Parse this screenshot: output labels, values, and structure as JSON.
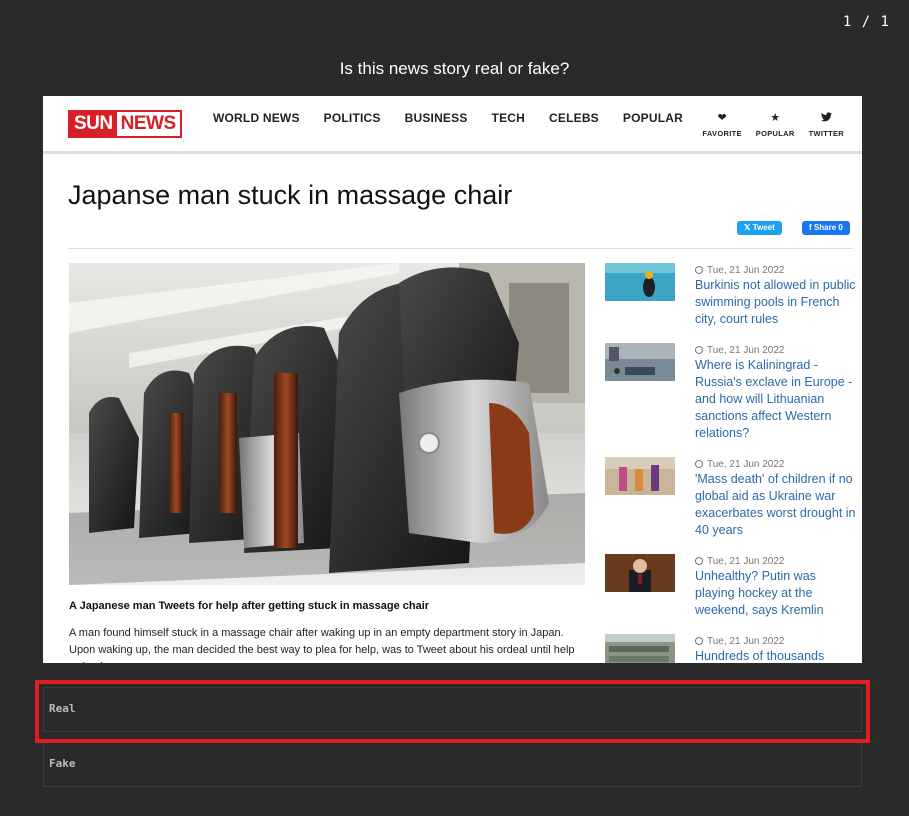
{
  "counter": "1 / 1",
  "question": "Is this news story real or fake?",
  "site": {
    "logo_sun": "SUN",
    "logo_news": "NEWS",
    "nav": [
      "WORLD NEWS",
      "POLITICS",
      "BUSINESS",
      "TECH",
      "CELEBS",
      "POPULAR"
    ],
    "tools": [
      {
        "icon": "heart-icon",
        "label": "FAVORITE"
      },
      {
        "icon": "star-icon",
        "label": "POPULAR"
      },
      {
        "icon": "twitter-icon",
        "label": "TWITTER"
      }
    ],
    "brand_color": "#d61f26"
  },
  "article": {
    "headline": "Japanse man stuck in massage chair",
    "tweet_label": "Tweet",
    "share_label": "Share 0",
    "caption": "A Japanese man Tweets for help after getting stuck in massage chair",
    "body": "A man found himself stuck in a massage chair after waking up in an empty department story in Japan. Upon waking up, the man decided the best way to plea for help, was to Tweet about his ordeal until help arrived."
  },
  "sidebar": [
    {
      "date": "Tue, 21 Jun 2022",
      "title": "Burkinis not allowed in public swimming pools in French city, court rules"
    },
    {
      "date": "Tue, 21 Jun 2022",
      "title": "Where is Kaliningrad - Russia's exclave in Europe - and how will Lithuanian sanctions affect Western relations?"
    },
    {
      "date": "Tue, 21 Jun 2022",
      "title": "'Mass death' of children if no global aid as Ukraine war exacerbates worst drought in 40 years"
    },
    {
      "date": "Tue, 21 Jun 2022",
      "title": "Unhealthy? Putin was playing hockey at the weekend, says Kremlin"
    },
    {
      "date": "Tue, 21 Jun 2022",
      "title": "Hundreds of thousands"
    }
  ],
  "options": {
    "real": "Real",
    "fake": "Fake"
  },
  "highlight_color": "#e01e1e"
}
